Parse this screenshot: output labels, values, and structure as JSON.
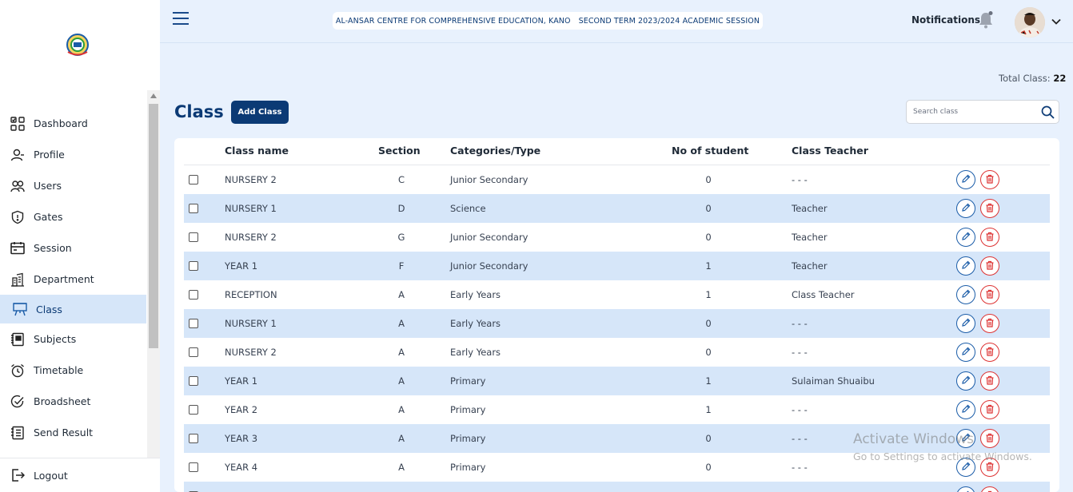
{
  "header": {
    "school_name": "AL-ANSAR CENTRE FOR COMPREHENSIVE EDUCATION, KANO",
    "term": "SECOND TERM 2023/2024 ACADEMIC SESSION",
    "notifications_label": "Notifications"
  },
  "sidebar": {
    "items": [
      {
        "label": "Dashboard",
        "icon": "dashboard-icon"
      },
      {
        "label": "Profile",
        "icon": "user-icon"
      },
      {
        "label": "Users",
        "icon": "users-icon"
      },
      {
        "label": "Gates",
        "icon": "shield-icon"
      },
      {
        "label": "Session",
        "icon": "calendar-icon"
      },
      {
        "label": "Department",
        "icon": "building-icon"
      },
      {
        "label": "Class",
        "icon": "easel-icon",
        "active": true
      },
      {
        "label": "Subjects",
        "icon": "book-icon"
      },
      {
        "label": "Timetable",
        "icon": "alarm-clock-icon"
      },
      {
        "label": "Broadsheet",
        "icon": "check-badge-icon"
      },
      {
        "label": "Send Result",
        "icon": "document-list-icon"
      }
    ],
    "logout_label": "Logout"
  },
  "main": {
    "total_label": "Total Class:",
    "total_value": "22",
    "title": "Class",
    "add_button": "Add Class",
    "search_placeholder": "Search class"
  },
  "table": {
    "columns": [
      "Class name",
      "Section",
      "Categories/Type",
      "No of student",
      "Class Teacher"
    ],
    "rows": [
      {
        "name": "NURSERY 2",
        "section": "C",
        "category": "Junior Secondary",
        "students": "0",
        "teacher": "- - -"
      },
      {
        "name": "NURSERY 1",
        "section": "D",
        "category": "Science",
        "students": "0",
        "teacher": "Teacher"
      },
      {
        "name": "NURSERY 2",
        "section": "G",
        "category": "Junior Secondary",
        "students": "0",
        "teacher": "Teacher"
      },
      {
        "name": "YEAR 1",
        "section": "F",
        "category": "Junior Secondary",
        "students": "1",
        "teacher": "Teacher"
      },
      {
        "name": "RECEPTION",
        "section": "A",
        "category": "Early Years",
        "students": "1",
        "teacher": "Class Teacher"
      },
      {
        "name": "NURSERY 1",
        "section": "A",
        "category": "Early Years",
        "students": "0",
        "teacher": "- - -"
      },
      {
        "name": "NURSERY 2",
        "section": "A",
        "category": "Early Years",
        "students": "0",
        "teacher": "- - -"
      },
      {
        "name": "YEAR 1",
        "section": "A",
        "category": "Primary",
        "students": "1",
        "teacher": "Sulaiman Shuaibu"
      },
      {
        "name": "YEAR 2",
        "section": "A",
        "category": "Primary",
        "students": "1",
        "teacher": "- - -"
      },
      {
        "name": "YEAR 3",
        "section": "A",
        "category": "Primary",
        "students": "0",
        "teacher": "- - -"
      },
      {
        "name": "YEAR 4",
        "section": "A",
        "category": "Primary",
        "students": "0",
        "teacher": "- - -"
      },
      {
        "name": "",
        "section": "",
        "category": "",
        "students": "",
        "teacher": ""
      }
    ]
  },
  "watermark": {
    "line1": "Activate Windows",
    "line2": "Go to Settings to activate Windows."
  },
  "colors": {
    "primary": "#0b3a75",
    "accent_blue": "#1a5ca8",
    "row_alt": "#d6e6f9",
    "page_bg": "#e8f1fd",
    "delete_red": "#dd3333"
  }
}
